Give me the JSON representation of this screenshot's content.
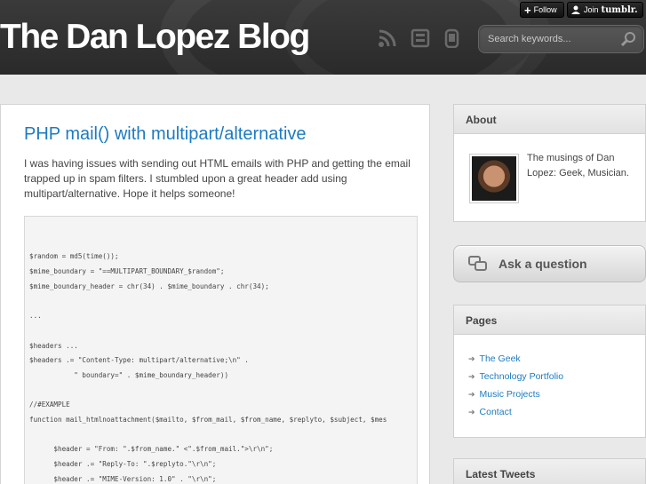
{
  "header": {
    "blog_title": "The Dan Lopez Blog",
    "search_placeholder": "Search keywords...",
    "icons": [
      "rss-icon",
      "archive-icon",
      "mobile-icon"
    ]
  },
  "tumblr": {
    "follow_label": "Follow",
    "join_label": "Join",
    "join_brand": "tumblr."
  },
  "post": {
    "title": "PHP mail() with multipart/alternative",
    "body": "I was having issues with sending out HTML emails with PHP and getting the email trapped up in spam filters. I stumbled upon a great header add using multipart/alternative. Hope it helps someone!",
    "code_lines": [
      "$random = md5(time());",
      "$mime_boundary = \"==MULTIPART_BOUNDARY_$random\";",
      "$mime_boundary_header = chr(34) . $mime_boundary . chr(34);",
      "...",
      "$headers ...",
      "$headers .= \"Content-Type: multipart/alternative;\\n\" .",
      "           \" boundary=\" . $mime_boundary_header))",
      "//#EXAMPLE",
      "function mail_htmlnoattachment($mailto, $from_mail, $from_name, $replyto, $subject, $mes",
      "      $header = \"From: \".$from_name.\" <\".$from_mail.\">\\r\\n\";",
      "      $header .= \"Reply-To: \".$replyto.\"\\r\\n\";",
      "      $header .= \"MIME-Version: 1.0\" . \"\\r\\n\";"
    ]
  },
  "sidebar": {
    "about": {
      "heading": "About",
      "text": "The musings of Dan Lopez: Geek, Musician."
    },
    "ask_label": "Ask a question",
    "pages": {
      "heading": "Pages",
      "links": [
        "The Geek",
        "Technology Portfolio",
        "Music Projects",
        "Contact"
      ]
    },
    "tweets_heading": "Latest Tweets"
  }
}
